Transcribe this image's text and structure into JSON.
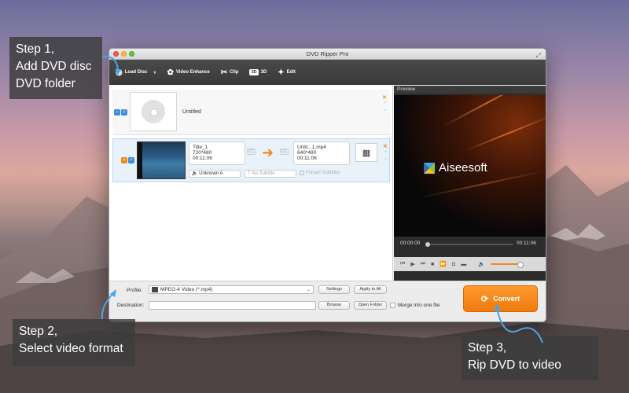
{
  "window": {
    "title": "DVD Ripper Pro"
  },
  "toolbar": {
    "load_disc": "Load Disc",
    "video_enhance": "Video Enhance",
    "clip": "Clip",
    "three_d_badge": "3D",
    "three_d": "3D",
    "edit": "Edit"
  },
  "disc_row": {
    "title": "Untitled"
  },
  "video_row": {
    "source_title": "Title_1",
    "source_res": "720*480",
    "source_time": "00:11:06",
    "output_name": "Untit...1.mp4",
    "output_res": "640*480",
    "output_time": "00:11:06",
    "audio": "Unknown A",
    "subtitle": "No Subtitle",
    "forced_subtitles": "Forced Subtitles",
    "cc_label": "CC"
  },
  "preview": {
    "label": "Preview",
    "brand": "Aiseesoft",
    "time_start": "00:00:00",
    "time_end": "00:11:06"
  },
  "bottom": {
    "profile_label": "Profile:",
    "profile_value": "MPEG-4 Video (*.mp4)",
    "settings": "Settings",
    "apply_to_all": "Apply to All",
    "destination_label": "Destination:",
    "destination_value": "",
    "browse": "Browse",
    "open_folder": "Open Folder",
    "merge": "Merge into one file",
    "convert": "Convert"
  },
  "callouts": {
    "step1": {
      "line1": "Step 1,",
      "line2": "Add DVD disc",
      "line3": "DVD folder"
    },
    "step2": {
      "line1": "Step 2,",
      "line2": "Select video format"
    },
    "step3": {
      "line1": "Step 3,",
      "line2": "Rip DVD to video"
    }
  },
  "colors": {
    "accent": "#f08a1c",
    "check": "#3d8ee0",
    "callout_arrow": "#4aa3e8"
  }
}
